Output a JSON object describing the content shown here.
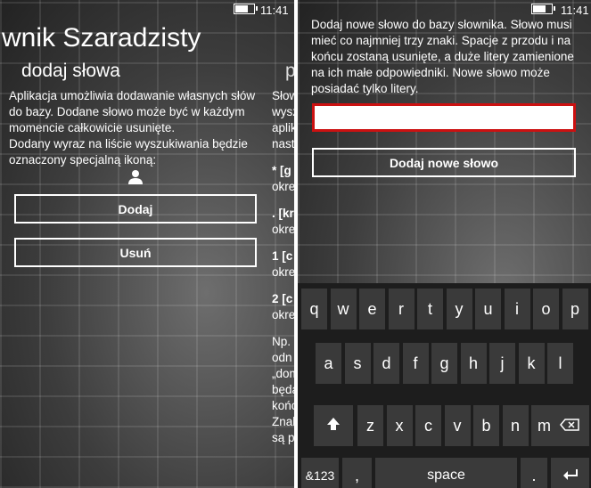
{
  "status": {
    "time": "11:41",
    "battery_level": 0.7
  },
  "left": {
    "app_title": "wnik Szaradzisty",
    "page_title": "dodaj słowa",
    "next_page_title_fragment": "p",
    "description_lines": [
      "Aplikacja umożliwia dodawanie własnych słów",
      "do bazy. Dodane słowo może być w każdym",
      "momencie całkowicie usunięte.",
      "Dodany wyraz na liście wyszukiwania będzie",
      "oznaczony specjalną ikoną:"
    ],
    "user_icon": "person-icon",
    "add_button": "Dodaj",
    "remove_button": "Usuń",
    "peek_lines": [
      "Słow",
      "wysz",
      "aplik",
      "nast",
      "* [g",
      "okre",
      ". [kr",
      "okre",
      "1 [c",
      "okre",
      "2 [c",
      "okre",
      "Np.",
      "odn",
      "„dom",
      "będą",
      "końc",
      "Znak",
      "są p"
    ]
  },
  "right": {
    "description_lines": [
      "Dodaj nowe słowo do bazy słownika. Słowo musi",
      "mieć co najmniej trzy znaki. Spacje z przodu i na",
      "końcu zostaną usunięte, a duże litery zamienione",
      "na ich małe odpowiedniki. Nowe słowo może",
      "posiadać tylko litery."
    ],
    "word_input_value": "",
    "add_word_button": "Dodaj nowe słowo",
    "input_border_color": "#cc1111"
  },
  "keyboard": {
    "row1": [
      "q",
      "w",
      "e",
      "r",
      "t",
      "y",
      "u",
      "i",
      "o",
      "p"
    ],
    "row2": [
      "a",
      "s",
      "d",
      "f",
      "g",
      "h",
      "j",
      "k",
      "l"
    ],
    "row3": [
      "z",
      "x",
      "c",
      "v",
      "b",
      "n",
      "m"
    ],
    "shift_icon": "shift-arrow-icon",
    "backspace_icon": "backspace-icon",
    "numbers_key": "&123",
    "comma_key": ",",
    "space_key": "space",
    "period_key": ".",
    "enter_icon": "enter-icon"
  }
}
